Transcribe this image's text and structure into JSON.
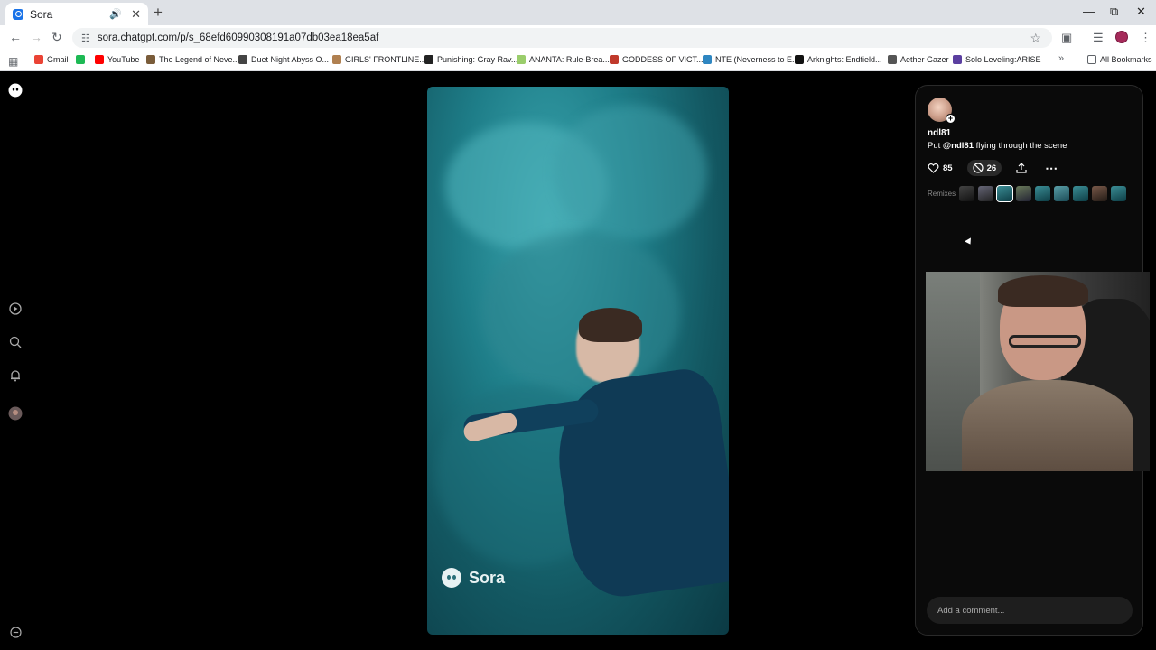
{
  "browser": {
    "tab_title": "Sora",
    "url": "sora.chatgpt.com/p/s_68efd60990308191a07db03ea18ea5af",
    "bookmarks": [
      {
        "label": "Gmail",
        "color": "#ea4335"
      },
      {
        "label": "",
        "color": "#1db954"
      },
      {
        "label": "YouTube",
        "color": "#ff0000"
      },
      {
        "label": "The Legend of Neve...",
        "color": "#7a5c3a"
      },
      {
        "label": "Duet Night Abyss O...",
        "color": "#444444"
      },
      {
        "label": "GIRLS' FRONTLINE...",
        "color": "#b08050"
      },
      {
        "label": "Punishing: Gray Rav...",
        "color": "#222222"
      },
      {
        "label": "ANANTA: Rule-Brea...",
        "color": "#9acd6b"
      },
      {
        "label": "GODDESS OF VICT...",
        "color": "#c0392b"
      },
      {
        "label": "NTE (Neverness to E...",
        "color": "#2e86c1"
      },
      {
        "label": "Arknights: Endfield...",
        "color": "#111111"
      },
      {
        "label": "Aether Gazer",
        "color": "#555555"
      },
      {
        "label": "Solo Leveling:ARISE",
        "color": "#5b3fa0"
      }
    ],
    "all_bookmarks_label": "All Bookmarks"
  },
  "video": {
    "watermark": "Sora"
  },
  "post": {
    "username": "ndl81",
    "caption_prefix": "Put ",
    "caption_mention": "@ndl81",
    "caption_suffix": " flying through the scene",
    "likes": "85",
    "remixes_count": "26",
    "remixes_label": "Remixes",
    "comment_placeholder": "Add a comment..."
  }
}
